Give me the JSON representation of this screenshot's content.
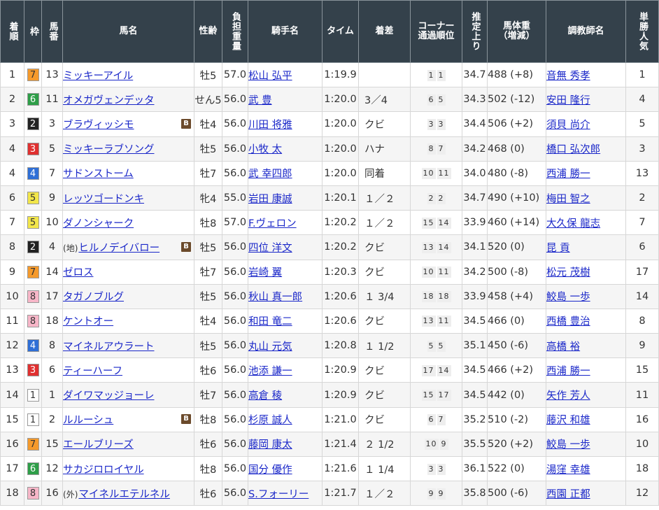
{
  "headers": {
    "no": "着順",
    "waku": "枠",
    "uma": "馬番",
    "name": "馬名",
    "sexage": "性齢",
    "burden": "負担重量",
    "jockey": "騎手名",
    "time": "タイム",
    "margin": "着差",
    "corner_top": "コーナー",
    "corner_bottom": "通過順位",
    "agari": "推定上り",
    "weight_top": "馬体重",
    "weight_bottom": "（増減）",
    "trainer": "調教師名",
    "pop": "単勝人気"
  },
  "waku_colors": {
    "1": {
      "bg": "#ffffff",
      "fg": "#333333"
    },
    "2": {
      "bg": "#222222",
      "fg": "#ffffff"
    },
    "3": {
      "bg": "#e03030",
      "fg": "#ffffff"
    },
    "4": {
      "bg": "#2f6fd6",
      "fg": "#ffffff"
    },
    "5": {
      "bg": "#f2e64a",
      "fg": "#333333"
    },
    "6": {
      "bg": "#2e9e48",
      "fg": "#ffffff"
    },
    "7": {
      "bg": "#f59a2c",
      "fg": "#333333"
    },
    "8": {
      "bg": "#f7b6c8",
      "fg": "#333333"
    }
  },
  "rows": [
    {
      "no": "1",
      "waku": "7",
      "uma": "13",
      "mark": "",
      "name": "ミッキーアイル",
      "blinker": "",
      "sexage": "牡5",
      "burden": "57.0",
      "jockey": "松山 弘平",
      "time": "1:19.9",
      "margin": "",
      "c1": "1",
      "c2": "1",
      "agari": "34.7",
      "weight": "488 (+8)",
      "trainer": "音無 秀孝",
      "pop": "1"
    },
    {
      "no": "2",
      "waku": "6",
      "uma": "11",
      "mark": "",
      "name": "オメガヴェンデッタ",
      "blinker": "",
      "sexage": "せん5",
      "burden": "56.0",
      "jockey": "武 豊",
      "time": "1:20.0",
      "margin": "3／4",
      "c1": "6",
      "c2": "5",
      "agari": "34.3",
      "weight": "502 (-12)",
      "trainer": "安田 隆行",
      "pop": "4"
    },
    {
      "no": "3",
      "waku": "2",
      "uma": "3",
      "mark": "",
      "name": "ブラヴィッシモ",
      "blinker": "B",
      "sexage": "牡4",
      "burden": "56.0",
      "jockey": "川田 将雅",
      "time": "1:20.0",
      "margin": "クビ",
      "c1": "3",
      "c2": "3",
      "agari": "34.4",
      "weight": "506 (+2)",
      "trainer": "須貝 尚介",
      "pop": "5"
    },
    {
      "no": "4",
      "waku": "3",
      "uma": "5",
      "mark": "",
      "name": "ミッキーラブソング",
      "blinker": "",
      "sexage": "牡5",
      "burden": "56.0",
      "jockey": "小牧 太",
      "time": "1:20.0",
      "margin": "ハナ",
      "c1": "8",
      "c2": "7",
      "agari": "34.2",
      "weight": "468 (0)",
      "trainer": "橋口 弘次郎",
      "pop": "3"
    },
    {
      "no": "4",
      "waku": "4",
      "uma": "7",
      "mark": "",
      "name": "サドンストーム",
      "blinker": "",
      "sexage": "牡7",
      "burden": "56.0",
      "jockey": "武 幸四郎",
      "time": "1:20.0",
      "margin": "同着",
      "c1": "10",
      "c2": "11",
      "agari": "34.0",
      "weight": "480 (-8)",
      "trainer": "西浦 勝一",
      "pop": "13"
    },
    {
      "no": "6",
      "waku": "5",
      "uma": "9",
      "mark": "",
      "name": "レッツゴードンキ",
      "blinker": "",
      "sexage": "牝4",
      "burden": "55.0",
      "jockey": "岩田 康誠",
      "time": "1:20.1",
      "margin": "１／２",
      "c1": "2",
      "c2": "2",
      "agari": "34.7",
      "weight": "490 (+10)",
      "trainer": "梅田 智之",
      "pop": "2"
    },
    {
      "no": "7",
      "waku": "5",
      "uma": "10",
      "mark": "",
      "name": "ダノンシャーク",
      "blinker": "",
      "sexage": "牡8",
      "burden": "57.0",
      "jockey": "F.ヴェロン",
      "time": "1:20.2",
      "margin": "１／２",
      "c1": "15",
      "c2": "14",
      "agari": "33.9",
      "weight": "460 (+14)",
      "trainer": "大久保 龍志",
      "pop": "7"
    },
    {
      "no": "8",
      "waku": "2",
      "uma": "4",
      "mark": "地",
      "name": "ヒルノデイバロー",
      "blinker": "B",
      "sexage": "牡5",
      "burden": "56.0",
      "jockey": "四位 洋文",
      "time": "1:20.2",
      "margin": "クビ",
      "c1": "13",
      "c2": "14",
      "agari": "34.1",
      "weight": "520 (0)",
      "trainer": "昆 貢",
      "pop": "6"
    },
    {
      "no": "9",
      "waku": "7",
      "uma": "14",
      "mark": "",
      "name": "ゼロス",
      "blinker": "",
      "sexage": "牡7",
      "burden": "56.0",
      "jockey": "岩崎 翼",
      "time": "1:20.3",
      "margin": "クビ",
      "c1": "10",
      "c2": "11",
      "agari": "34.2",
      "weight": "500 (-8)",
      "trainer": "松元 茂樹",
      "pop": "17"
    },
    {
      "no": "10",
      "waku": "8",
      "uma": "17",
      "mark": "",
      "name": "タガノブルグ",
      "blinker": "",
      "sexage": "牡5",
      "burden": "56.0",
      "jockey": "秋山 真一郎",
      "time": "1:20.6",
      "margin": "１ 3/4",
      "c1": "18",
      "c2": "18",
      "agari": "33.9",
      "weight": "458 (+4)",
      "trainer": "鮫島 一歩",
      "pop": "14"
    },
    {
      "no": "11",
      "waku": "8",
      "uma": "18",
      "mark": "",
      "name": "ケントオー",
      "blinker": "",
      "sexage": "牡4",
      "burden": "56.0",
      "jockey": "和田 竜二",
      "time": "1:20.6",
      "margin": "クビ",
      "c1": "13",
      "c2": "11",
      "agari": "34.5",
      "weight": "466 (0)",
      "trainer": "西橋 豊治",
      "pop": "8"
    },
    {
      "no": "12",
      "waku": "4",
      "uma": "8",
      "mark": "",
      "name": "マイネルアウラート",
      "blinker": "",
      "sexage": "牡5",
      "burden": "56.0",
      "jockey": "丸山 元気",
      "time": "1:20.8",
      "margin": "１ 1/2",
      "c1": "5",
      "c2": "5",
      "agari": "35.1",
      "weight": "450 (-6)",
      "trainer": "高橋 裕",
      "pop": "9"
    },
    {
      "no": "13",
      "waku": "3",
      "uma": "6",
      "mark": "",
      "name": "ティーハーフ",
      "blinker": "",
      "sexage": "牡6",
      "burden": "56.0",
      "jockey": "池添 謙一",
      "time": "1:20.9",
      "margin": "クビ",
      "c1": "17",
      "c2": "14",
      "agari": "34.5",
      "weight": "466 (+2)",
      "trainer": "西浦 勝一",
      "pop": "15"
    },
    {
      "no": "14",
      "waku": "1",
      "uma": "1",
      "mark": "",
      "name": "ダイワマッジョーレ",
      "blinker": "",
      "sexage": "牡7",
      "burden": "56.0",
      "jockey": "高倉 稜",
      "time": "1:20.9",
      "margin": "クビ",
      "c1": "15",
      "c2": "17",
      "agari": "34.5",
      "weight": "442 (0)",
      "trainer": "矢作 芳人",
      "pop": "11"
    },
    {
      "no": "15",
      "waku": "1",
      "uma": "2",
      "mark": "",
      "name": "ルルーシュ",
      "blinker": "B",
      "sexage": "牡8",
      "burden": "56.0",
      "jockey": "杉原 誠人",
      "time": "1:21.0",
      "margin": "クビ",
      "c1": "6",
      "c2": "7",
      "agari": "35.2",
      "weight": "510 (-2)",
      "trainer": "藤沢 和雄",
      "pop": "16"
    },
    {
      "no": "16",
      "waku": "7",
      "uma": "15",
      "mark": "",
      "name": "エールブリーズ",
      "blinker": "",
      "sexage": "牡6",
      "burden": "56.0",
      "jockey": "藤岡 康太",
      "time": "1:21.4",
      "margin": "２ 1/2",
      "c1": "10",
      "c2": "9",
      "agari": "35.5",
      "weight": "520 (+2)",
      "trainer": "鮫島 一歩",
      "pop": "10"
    },
    {
      "no": "17",
      "waku": "6",
      "uma": "12",
      "mark": "",
      "name": "サカジロロイヤル",
      "blinker": "",
      "sexage": "牡8",
      "burden": "56.0",
      "jockey": "国分 優作",
      "time": "1:21.6",
      "margin": "１ 1/4",
      "c1": "3",
      "c2": "3",
      "agari": "36.1",
      "weight": "522 (0)",
      "trainer": "湯窪 幸雄",
      "pop": "18"
    },
    {
      "no": "18",
      "waku": "8",
      "uma": "16",
      "mark": "外",
      "name": "マイネルエテルネル",
      "blinker": "",
      "sexage": "牡6",
      "burden": "56.0",
      "jockey": "S.フォーリー",
      "time": "1:21.7",
      "margin": "１／２",
      "c1": "9",
      "c2": "9",
      "agari": "35.8",
      "weight": "500 (-6)",
      "trainer": "西園 正都",
      "pop": "12"
    }
  ]
}
